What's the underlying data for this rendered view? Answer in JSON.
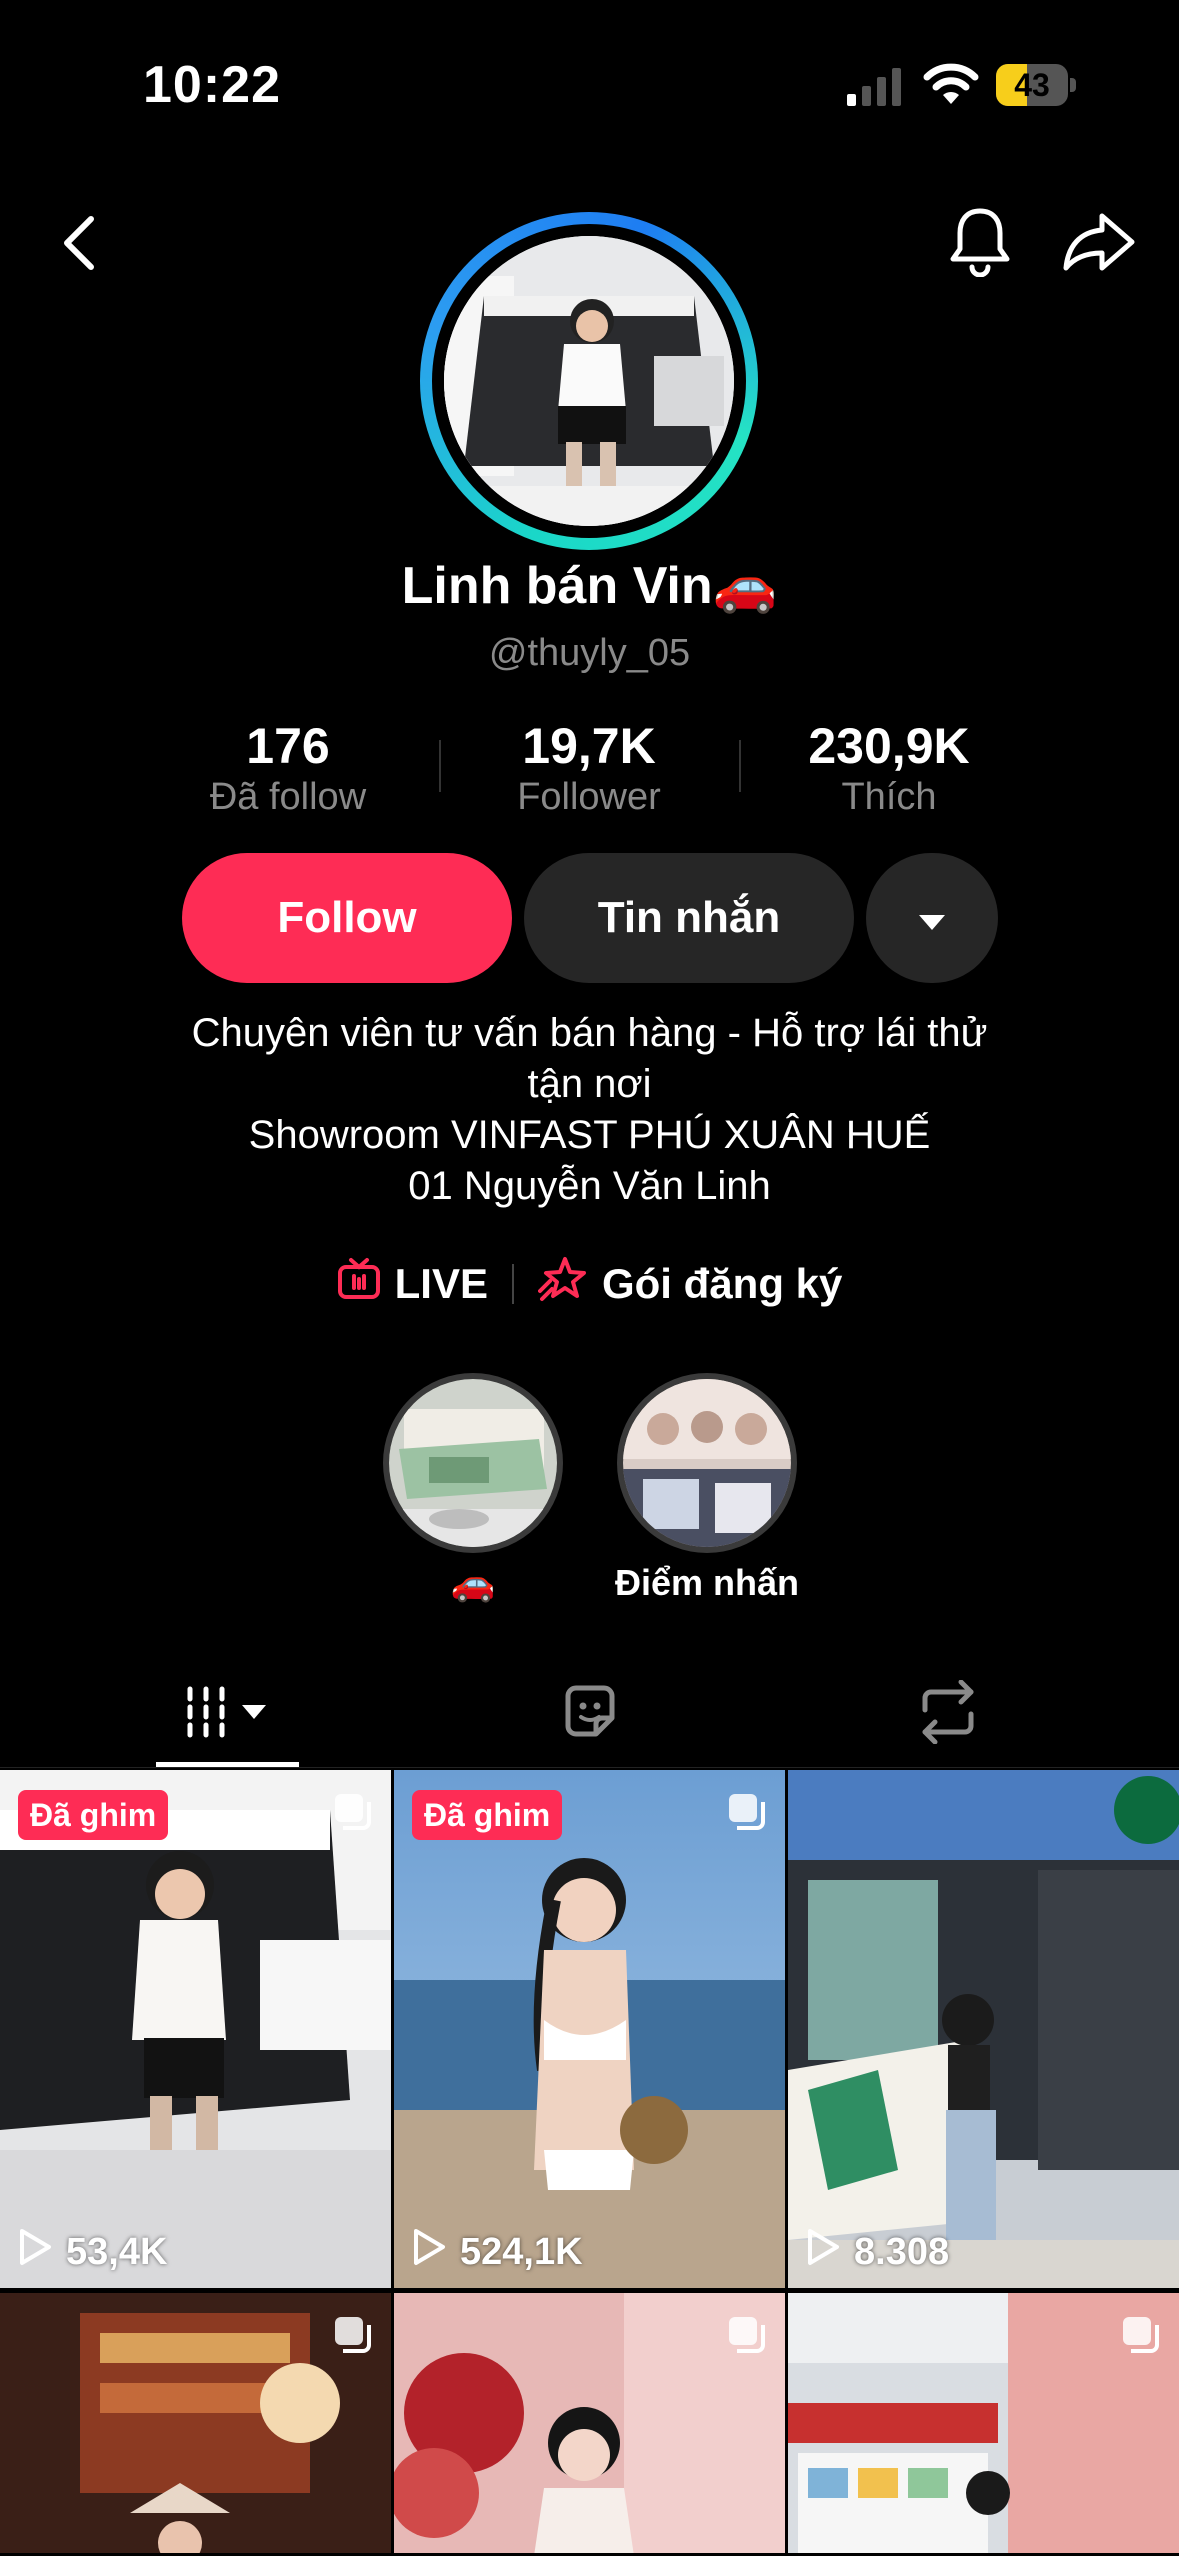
{
  "status_bar": {
    "time": "10:22",
    "battery_percent": "43",
    "battery_level": 0.43
  },
  "profile": {
    "display_name": "Linh bán Vin🚗",
    "handle": "@thuyly_05",
    "stats": [
      {
        "value": "176",
        "label": "Đã follow"
      },
      {
        "value": "19,7K",
        "label": "Follower"
      },
      {
        "value": "230,9K",
        "label": "Thích"
      }
    ],
    "follow_label": "Follow",
    "message_label": "Tin nhắn",
    "bio": "Chuyên viên tư vấn bán hàng - Hỗ trợ lái thử\ntận nơi\nShowroom VINFAST PHÚ XUÂN HUẾ\n01 Nguyễn Văn Linh",
    "live_label": "LIVE",
    "subscription_label": "Gói đăng ký"
  },
  "highlights": [
    {
      "label": "🚗"
    },
    {
      "label": "Điểm nhấn"
    }
  ],
  "tabs": [
    {
      "name": "videos",
      "icon": "grid-icon",
      "active": true
    },
    {
      "name": "stickers",
      "icon": "sticker-icon",
      "active": false
    },
    {
      "name": "reposts",
      "icon": "repost-icon",
      "active": false
    }
  ],
  "videos": [
    {
      "pinned_label": "Đã ghim",
      "views": "53,4K"
    },
    {
      "pinned_label": "Đã ghim",
      "views": "524,1K"
    },
    {
      "pinned_label": "",
      "views": "8.308"
    },
    {
      "pinned_label": "",
      "views": ""
    },
    {
      "pinned_label": "",
      "views": ""
    },
    {
      "pinned_label": "",
      "views": ""
    }
  ],
  "colors": {
    "accent": "#fe2c55",
    "muted": "#8a8a8a",
    "button_dark": "#262626",
    "battery": "#f7ce1b"
  }
}
